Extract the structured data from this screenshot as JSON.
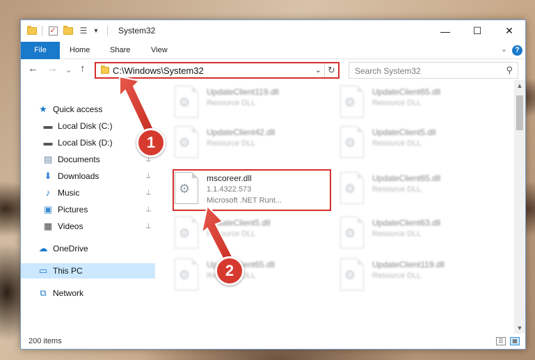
{
  "window": {
    "title": "System32",
    "controls": {
      "minimize": "—",
      "maximize": "☐",
      "close": "✕"
    }
  },
  "ribbon": {
    "tabs": [
      "File",
      "Home",
      "Share",
      "View"
    ],
    "help": "?",
    "collapse": "⌄"
  },
  "navbar": {
    "back": "←",
    "forward": "→",
    "recent": "⌄",
    "up": "↑",
    "address": "C:\\Windows\\System32",
    "address_dropdown": "⌄",
    "refresh": "↻",
    "search_placeholder": "Search System32",
    "search_icon": "⚲"
  },
  "sidebar": {
    "items": [
      {
        "label": "Quick access",
        "icon": "star-icon",
        "glyph": "★",
        "color": "#1979ca",
        "pinned": false,
        "selected": false
      },
      {
        "label": "Local Disk (C:)",
        "icon": "drive-icon",
        "glyph": "▬",
        "color": "#555555",
        "pinned": true,
        "selected": false
      },
      {
        "label": "Local Disk (D:)",
        "icon": "drive-icon",
        "glyph": "▬",
        "color": "#555555",
        "pinned": true,
        "selected": false
      },
      {
        "label": "Documents",
        "icon": "documents-icon",
        "glyph": "▤",
        "color": "#6a7fa8",
        "pinned": true,
        "selected": false
      },
      {
        "label": "Downloads",
        "icon": "downloads-icon",
        "glyph": "⬇",
        "color": "#2a7fd4",
        "pinned": true,
        "selected": false
      },
      {
        "label": "Music",
        "icon": "music-icon",
        "glyph": "♪",
        "color": "#1979ca",
        "pinned": true,
        "selected": false
      },
      {
        "label": "Pictures",
        "icon": "pictures-icon",
        "glyph": "▣",
        "color": "#3a8ad0",
        "pinned": true,
        "selected": false
      },
      {
        "label": "Videos",
        "icon": "videos-icon",
        "glyph": "▦",
        "color": "#444444",
        "pinned": true,
        "selected": false
      },
      {
        "label": "OneDrive",
        "icon": "onedrive-icon",
        "glyph": "☁",
        "color": "#1979ca",
        "pinned": false,
        "selected": false
      },
      {
        "label": "This PC",
        "icon": "this-pc-icon",
        "glyph": "▭",
        "color": "#1979ca",
        "pinned": false,
        "selected": true
      },
      {
        "label": "Network",
        "icon": "network-icon",
        "glyph": "⧉",
        "color": "#1979ca",
        "pinned": false,
        "selected": false
      }
    ],
    "pin_glyph": "📌"
  },
  "files": [
    {
      "name": "UpdateClient119.dll",
      "meta": "Resource DLL",
      "meta2": "",
      "highlight": false
    },
    {
      "name": "UpdateClient65.dll",
      "meta": "Resource DLL",
      "meta2": "",
      "highlight": false
    },
    {
      "name": "UpdateClient42.dll",
      "meta": "Resource DLL",
      "meta2": "",
      "highlight": false
    },
    {
      "name": "UpdateClient5.dll",
      "meta": "Resource DLL",
      "meta2": "",
      "highlight": false
    },
    {
      "name": "mscoreer.dll",
      "meta": "1.1.4322.573",
      "meta2": "Microsoft .NET Runt...",
      "highlight": true
    },
    {
      "name": "UpdateClient65.dll",
      "meta": "Resource DLL",
      "meta2": "",
      "highlight": false
    },
    {
      "name": "UpdateClient5.dll",
      "meta": "Resource DLL",
      "meta2": "",
      "highlight": false
    },
    {
      "name": "UpdateClient63.dll",
      "meta": "Resource DLL",
      "meta2": "",
      "highlight": false
    },
    {
      "name": "UpdateClient65.dll",
      "meta": "Resource DLL",
      "meta2": "",
      "highlight": false
    },
    {
      "name": "UpdateClient119.dll",
      "meta": "Resource DLL",
      "meta2": "",
      "highlight": false
    }
  ],
  "status": {
    "count": "200 items"
  },
  "annotations": [
    {
      "label": "1",
      "color": "#d63a2f"
    },
    {
      "label": "2",
      "color": "#d63a2f"
    }
  ]
}
